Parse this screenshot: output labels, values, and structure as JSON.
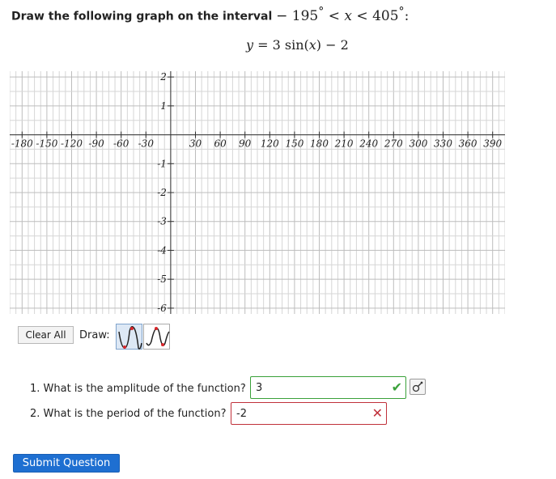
{
  "prompt": {
    "text": "Draw the following graph on the interval ",
    "interval_lower": "− 195",
    "interval_degree": "°",
    "interval_ineq1": " < ",
    "interval_var": "x",
    "interval_ineq2": " < ",
    "interval_upper": "405",
    "interval_degree2": "°",
    "interval_colon": ":"
  },
  "equation": {
    "lhs": "y",
    "eq": " = 3 sin(",
    "arg": "x",
    "rest": ") − 2"
  },
  "graph": {
    "x_tick_labels": [
      "-180",
      "-150",
      "-120",
      "-90",
      "-60",
      "-30",
      "30",
      "60",
      "90",
      "120",
      "150",
      "180",
      "210",
      "240",
      "270",
      "300",
      "330",
      "360",
      "390"
    ],
    "x_tick_values": [
      -180,
      -150,
      -120,
      -90,
      -60,
      -30,
      30,
      60,
      90,
      120,
      150,
      180,
      210,
      240,
      270,
      300,
      330,
      360,
      390
    ],
    "y_tick_labels": [
      "2",
      "1",
      "-1",
      "-2",
      "-3",
      "-4",
      "-5",
      "-6"
    ],
    "y_tick_values": [
      2,
      1,
      -1,
      -2,
      -3,
      -4,
      -5,
      -6
    ],
    "x_range": [
      -195,
      405
    ],
    "y_range": [
      -6.2,
      2.2
    ],
    "grid": true
  },
  "toolbar": {
    "clear_label": "Clear All",
    "draw_label": "Draw:",
    "tools": [
      "sine-wave-tool",
      "sine-wave-tool-alt"
    ]
  },
  "questions": [
    {
      "label": "1. What is the amplitude of the function?",
      "answer": "3",
      "status": "correct",
      "status_color": "#3aa13a"
    },
    {
      "label": "2. What is the period of the function?",
      "answer": "-2",
      "status": "incorrect",
      "status_color": "#c0303a"
    }
  ],
  "submit_label": "Submit Question",
  "colors": {
    "accent": "#1e6fd1",
    "correct": "#3aa13a",
    "incorrect": "#c0303a",
    "point": "#d9262b"
  }
}
